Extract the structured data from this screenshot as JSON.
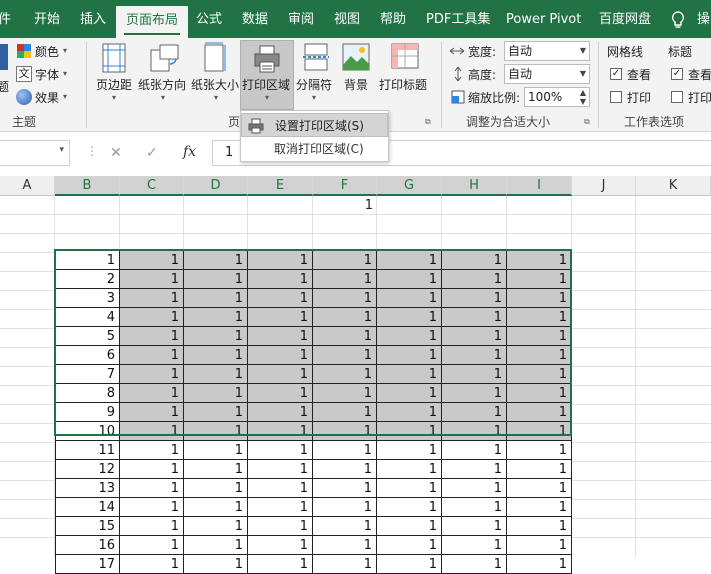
{
  "tabs": [
    "件",
    "开始",
    "插入",
    "页面布局",
    "公式",
    "数据",
    "审阅",
    "视图",
    "帮助",
    "PDF工具集",
    "Power Pivot",
    "百度网盘",
    "操"
  ],
  "active_tab": "页面布局",
  "ribbon": {
    "theme": {
      "colors": "颜色",
      "fonts": "字体",
      "effects": "效果",
      "group_label": "主题",
      "left_cut": "题"
    },
    "page_setup": {
      "margins": "页边距",
      "orientation": "纸张方向",
      "size": "纸张大小",
      "print_area": "打印区域",
      "breaks": "分隔符",
      "background": "背景",
      "print_titles": "打印标题",
      "group_label": "页"
    },
    "scale_to_fit": {
      "width_label": "宽度:",
      "width_value": "自动",
      "height_label": "高度:",
      "height_value": "自动",
      "scale_label": "缩放比例:",
      "scale_value": "100%",
      "group_label": "调整为合适大小"
    },
    "sheet_options": {
      "gridlines": "网格线",
      "headings": "标题",
      "view": "查看",
      "print": "打印",
      "group_label": "工作表选项"
    }
  },
  "print_area_menu": {
    "set": "设置打印区域(S)",
    "clear": "取消打印区域(C)"
  },
  "formula_bar": {
    "fx": "fx",
    "value": "1",
    "cancel": "✕",
    "enter": "✓"
  },
  "grid": {
    "columns": [
      "A",
      "B",
      "C",
      "D",
      "E",
      "F",
      "G",
      "H",
      "I",
      "J",
      "K"
    ],
    "f_top_value": "1",
    "rows": [
      {
        "label": "1",
        "shaded": true
      },
      {
        "label": "2",
        "shaded": true
      },
      {
        "label": "3",
        "shaded": true
      },
      {
        "label": "4",
        "shaded": true
      },
      {
        "label": "5",
        "shaded": true
      },
      {
        "label": "6",
        "shaded": true
      },
      {
        "label": "7",
        "shaded": true
      },
      {
        "label": "8",
        "shaded": true
      },
      {
        "label": "9",
        "shaded": true
      },
      {
        "label": "10",
        "shaded": true
      },
      {
        "label": "11",
        "shaded": false
      },
      {
        "label": "12",
        "shaded": false
      },
      {
        "label": "13",
        "shaded": false
      },
      {
        "label": "14",
        "shaded": false
      },
      {
        "label": "15",
        "shaded": false
      },
      {
        "label": "16",
        "shaded": false
      },
      {
        "label": "17",
        "shaded": false
      }
    ],
    "cell_value": "1"
  },
  "colors": {
    "accent": "#217346",
    "selection_fill": "#c9c9c9"
  }
}
